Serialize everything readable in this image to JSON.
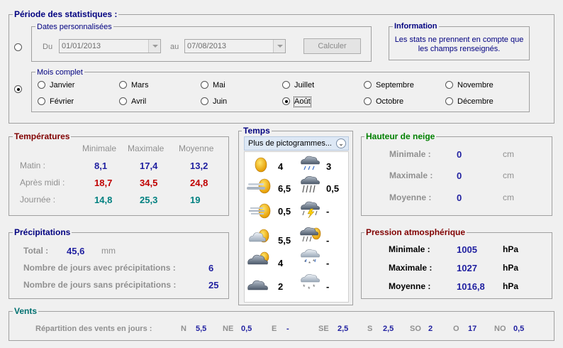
{
  "periode": {
    "title": "Période des statistiques :",
    "dates": {
      "legend": "Dates personnalisées",
      "from_label": "Du",
      "from_value": "01/01/2013",
      "to_label": "au",
      "to_value": "07/08/2013",
      "button": "Calculer"
    },
    "info": {
      "legend": "Information",
      "line1": "Les stats ne prennent en compte que",
      "line2": "les champs renseignés."
    },
    "mois": {
      "legend": "Mois complet",
      "months": [
        "Janvier",
        "Février",
        "Mars",
        "Avril",
        "Mai",
        "Juin",
        "Juillet",
        "Août",
        "Septembre",
        "Octobre",
        "Novembre",
        "Décembre"
      ],
      "selected": "Août"
    }
  },
  "temperatures": {
    "title": "Températures",
    "headers": [
      "Minimale",
      "Maximale",
      "Moyenne"
    ],
    "rows": [
      {
        "label": "Matin :",
        "min": "8,1",
        "max": "17,4",
        "moy": "13,2"
      },
      {
        "label": "Après midi :",
        "min": "18,7",
        "max": "34,5",
        "moy": "24,8"
      },
      {
        "label": "Journée :",
        "min": "14,8",
        "max": "25,3",
        "moy": "19"
      }
    ]
  },
  "temps": {
    "title": "Temps",
    "dropdown": "Plus de pictogrammes...",
    "left": [
      {
        "icon": "sun-icon",
        "value": "4"
      },
      {
        "icon": "sun-fog-icon",
        "value": "6,5"
      },
      {
        "icon": "haze-sun-icon",
        "value": "0,5"
      },
      {
        "icon": "partly-cloudy-icon",
        "value": "5,5"
      },
      {
        "icon": "mostly-cloudy-icon",
        "value": "4"
      },
      {
        "icon": "overcast-icon",
        "value": "2"
      }
    ],
    "right": [
      {
        "icon": "rain-cloud-icon",
        "value": "3"
      },
      {
        "icon": "heavy-rain-icon",
        "value": "0,5"
      },
      {
        "icon": "thunderstorm-icon",
        "value": "-"
      },
      {
        "icon": "sun-shower-icon",
        "value": "-"
      },
      {
        "icon": "sleet-icon",
        "value": "-"
      },
      {
        "icon": "snow-icon",
        "value": "-"
      }
    ]
  },
  "neige": {
    "title": "Hauteur de neige",
    "rows": [
      {
        "label": "Minimale :",
        "value": "0",
        "unit": "cm"
      },
      {
        "label": "Maximale :",
        "value": "0",
        "unit": "cm"
      },
      {
        "label": "Moyenne :",
        "value": "0",
        "unit": "cm"
      }
    ]
  },
  "precipitations": {
    "title": "Précipitations",
    "total_label": "Total :",
    "total_value": "45,6",
    "total_unit": "mm",
    "avec_label": "Nombre de jours avec précipitations :",
    "avec_value": "6",
    "sans_label": "Nombre de jours sans précipitations :",
    "sans_value": "25"
  },
  "pression": {
    "title": "Pression atmosphérique",
    "rows": [
      {
        "label": "Minimale :",
        "value": "1005",
        "unit": "hPa"
      },
      {
        "label": "Maximale :",
        "value": "1027",
        "unit": "hPa"
      },
      {
        "label": "Moyenne :",
        "value": "1016,8",
        "unit": "hPa"
      }
    ]
  },
  "vents": {
    "title": "Vents",
    "label": "Répartition des vents en jours :",
    "dirs": [
      {
        "k": "N",
        "v": "5,5"
      },
      {
        "k": "NE",
        "v": "0,5"
      },
      {
        "k": "E",
        "v": "-"
      },
      {
        "k": "SE",
        "v": "2,5"
      },
      {
        "k": "S",
        "v": "2,5"
      },
      {
        "k": "SO",
        "v": "2"
      },
      {
        "k": "O",
        "v": "17"
      },
      {
        "k": "NO",
        "v": "0,5"
      }
    ]
  },
  "colors": {
    "accent_dark": "#000080",
    "temp_red": "#800000",
    "snow_green": "#008000",
    "wind_teal": "#007070"
  }
}
